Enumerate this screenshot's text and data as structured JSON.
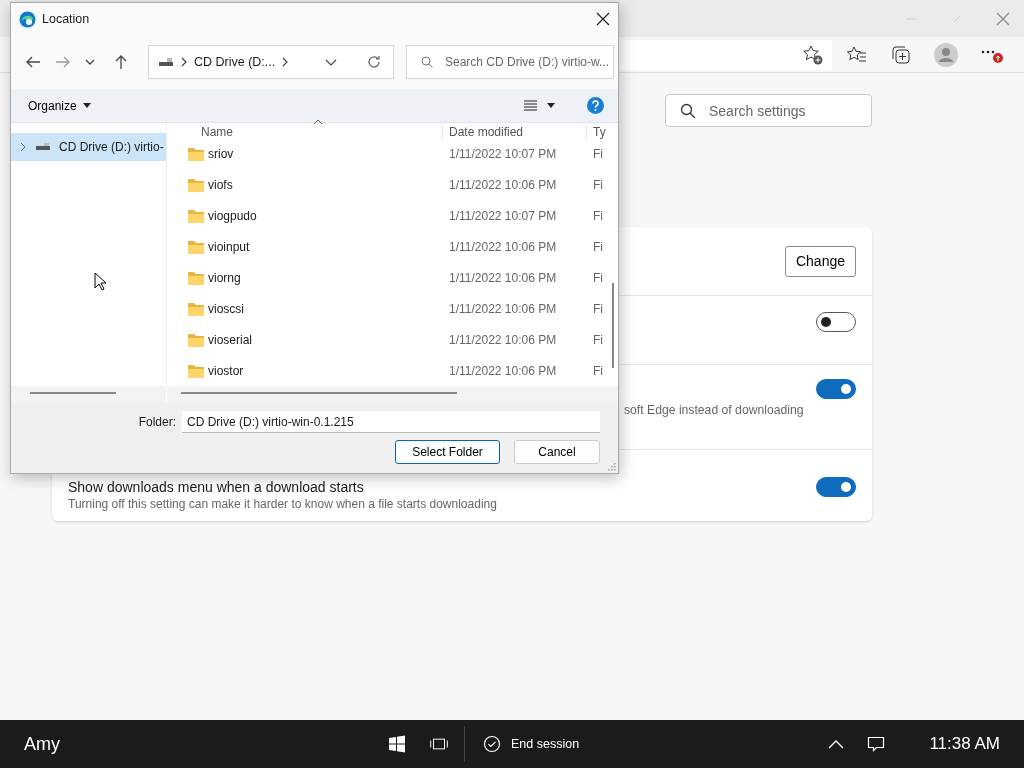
{
  "browser": {
    "settings_search": {
      "placeholder": "Search settings"
    },
    "rows": [
      {
        "kind": "button",
        "button": "Change"
      },
      {
        "kind": "toggle",
        "on": false
      },
      {
        "kind": "toggle",
        "on": true,
        "description": "soft Edge instead of downloading"
      },
      {
        "kind": "toggle",
        "on": true,
        "title": "Show downloads menu when a download starts",
        "description": "Turning off this setting can make it harder to know when a file starts downloading"
      }
    ]
  },
  "dialog": {
    "title": "Location",
    "address": {
      "crumb": "CD Drive (D:..."
    },
    "search": {
      "placeholder": "Search CD Drive (D:) virtio-w..."
    },
    "organize": "Organize",
    "nav_pane": {
      "items": [
        {
          "label": "CD Drive (D:) virtio-",
          "selected": true,
          "expanded": false
        }
      ]
    },
    "file_list": {
      "columns": [
        "Name",
        "Date modified",
        "Ty"
      ],
      "rows": [
        {
          "name": "sriov",
          "date": "1/11/2022 10:07 PM",
          "type": "Fi"
        },
        {
          "name": "viofs",
          "date": "1/11/2022 10:06 PM",
          "type": "Fi"
        },
        {
          "name": "viogpudo",
          "date": "1/11/2022 10:07 PM",
          "type": "Fi"
        },
        {
          "name": "vioinput",
          "date": "1/11/2022 10:06 PM",
          "type": "Fi"
        },
        {
          "name": "viorng",
          "date": "1/11/2022 10:06 PM",
          "type": "Fi"
        },
        {
          "name": "vioscsi",
          "date": "1/11/2022 10:06 PM",
          "type": "Fi"
        },
        {
          "name": "vioserial",
          "date": "1/11/2022 10:06 PM",
          "type": "Fi"
        },
        {
          "name": "viostor",
          "date": "1/11/2022 10:06 PM",
          "type": "Fi"
        }
      ]
    },
    "folder": {
      "label": "Folder:",
      "value": "CD Drive (D:) virtio-win-0.1.215"
    },
    "buttons": [
      {
        "label": "Select Folder",
        "default": true
      },
      {
        "label": "Cancel",
        "default": false
      }
    ]
  },
  "taskbar": {
    "user": "Amy",
    "end_session": "End session",
    "clock": "11:38 AM"
  }
}
